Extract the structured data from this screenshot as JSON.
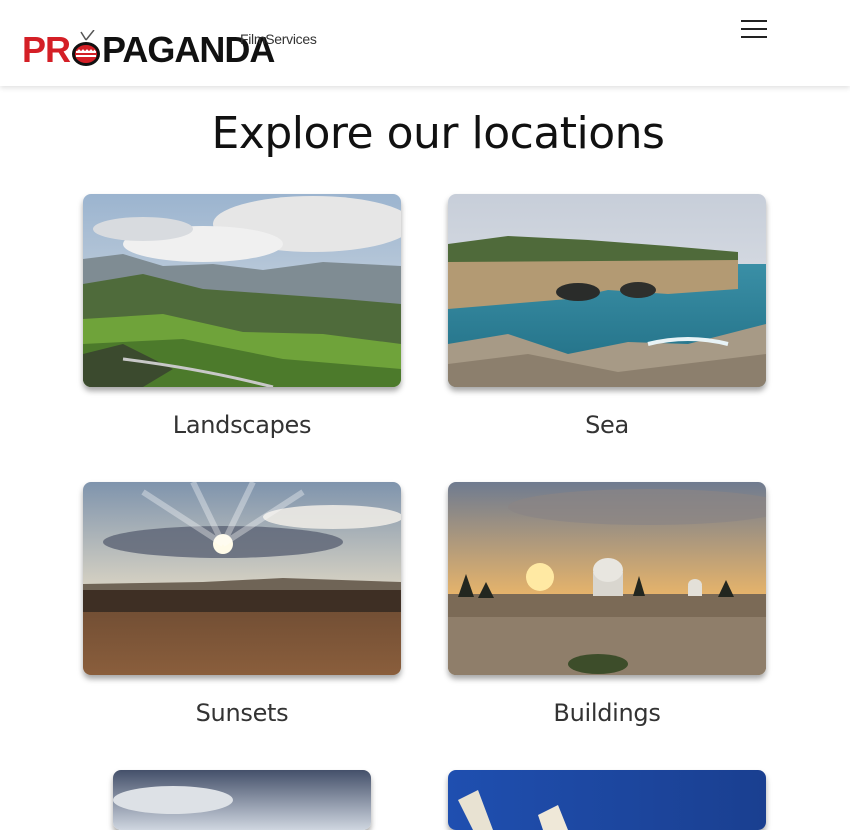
{
  "header": {
    "logo_text_red_1": "PR",
    "logo_text_dark": "PAGANDA",
    "brand_prefix": "Film",
    "brand_suffix": "Services",
    "menu_icon": "hamburger-icon"
  },
  "main": {
    "title": "Explore our locations",
    "cards": [
      {
        "label": "Landscapes"
      },
      {
        "label": "Sea"
      },
      {
        "label": "Sunsets"
      },
      {
        "label": "Buildings"
      },
      {
        "label": ""
      },
      {
        "label": ""
      }
    ]
  },
  "colors": {
    "brand_red": "#d41f26",
    "text_dark": "#111111",
    "label_text": "#333333"
  }
}
